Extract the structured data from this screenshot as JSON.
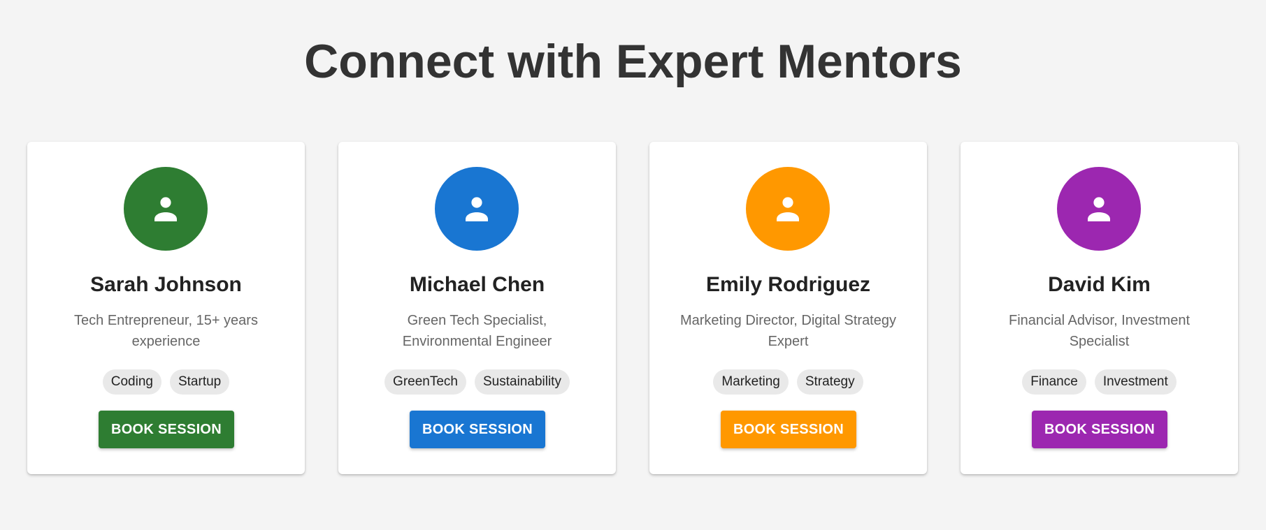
{
  "page": {
    "title": "Connect with Expert Mentors"
  },
  "mentors": [
    {
      "name": "Sarah Johnson",
      "description": "Tech Entrepreneur, 15+ years experience",
      "tags": [
        "Coding",
        "Startup"
      ],
      "button_label": "BOOK SESSION",
      "color": "#2e7d32",
      "avatar_icon": "person-icon"
    },
    {
      "name": "Michael Chen",
      "description": "Green Tech Specialist, Environmental Engineer",
      "tags": [
        "GreenTech",
        "Sustainability"
      ],
      "button_label": "BOOK SESSION",
      "color": "#1976d2",
      "avatar_icon": "person-icon"
    },
    {
      "name": "Emily Rodriguez",
      "description": "Marketing Director, Digital Strategy Expert",
      "tags": [
        "Marketing",
        "Strategy"
      ],
      "button_label": "BOOK SESSION",
      "color": "#ff9800",
      "avatar_icon": "person-icon"
    },
    {
      "name": "David Kim",
      "description": "Financial Advisor, Investment Specialist",
      "tags": [
        "Finance",
        "Investment"
      ],
      "button_label": "BOOK SESSION",
      "color": "#9c27b0",
      "avatar_icon": "person-icon"
    }
  ]
}
